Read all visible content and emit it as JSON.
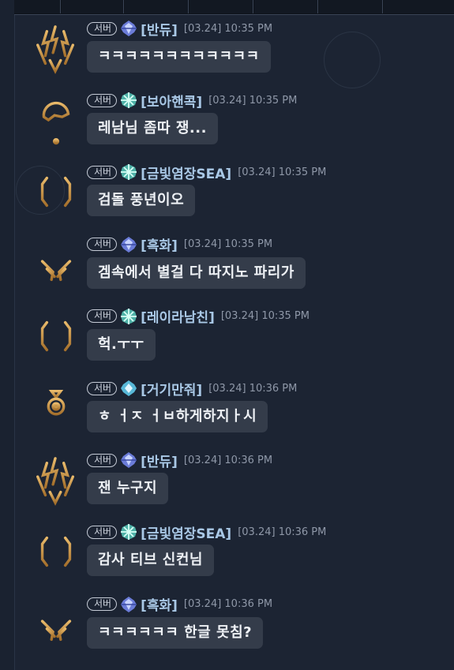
{
  "messages": [
    {
      "avatar": "lightning-emblem",
      "rank": "blue-gem",
      "server": "서버",
      "name": "[반듀]",
      "time": "[03.24] 10:35 PM",
      "text": "ㅋㅋㅋㅋㅋㅋㅋㅋㅋㅋㅋㅋ"
    },
    {
      "avatar": "helmet-emblem",
      "rank": "teal-gem",
      "server": "서버",
      "name": "[보아핸콕]",
      "time": "[03.24] 10:35 PM",
      "text": "레남님 좀따 쟁..."
    },
    {
      "avatar": "shield-ring-emblem",
      "rank": "teal-gem",
      "server": "서버",
      "name": "[금빛염장SEA]",
      "time": "[03.24] 10:35 PM",
      "text": "검돌 풍년이오"
    },
    {
      "avatar": "sword-wing-emblem",
      "rank": "blue-gem",
      "server": "서버",
      "name": "[흑화]",
      "time": "[03.24] 10:35 PM",
      "text": "겜속에서 별걸 다 따지노 파리가"
    },
    {
      "avatar": "shield-ring-emblem",
      "rank": "teal-gem",
      "server": "서버",
      "name": "[레이라남친]",
      "time": "[03.24] 10:35 PM",
      "text": "헉.ㅜㅜ"
    },
    {
      "avatar": "scepter-emblem",
      "rank": "cyan-gem",
      "server": "서버",
      "name": "[거기만줘]",
      "time": "[03.24] 10:36 PM",
      "text": "ㅎ ㅓㅈ ㅓㅂ하게하지ㅏ시"
    },
    {
      "avatar": "lightning-emblem",
      "rank": "blue-gem",
      "server": "서버",
      "name": "[반듀]",
      "time": "[03.24] 10:36 PM",
      "text": "잰 누구지"
    },
    {
      "avatar": "shield-ring-emblem",
      "rank": "teal-gem",
      "server": "서버",
      "name": "[금빛염장SEA]",
      "time": "[03.24] 10:36 PM",
      "text": "감사 티브 신컨님"
    },
    {
      "avatar": "sword-wing-emblem",
      "rank": "blue-gem",
      "server": "서버",
      "name": "[흑화]",
      "time": "[03.24] 10:36 PM",
      "text": "ㅋㅋㅋㅋㅋㅋ 한글 못침?"
    }
  ],
  "colors": {
    "name": "#a9c8e6",
    "bubble": "#343c4a",
    "gold": "#c9974a"
  }
}
